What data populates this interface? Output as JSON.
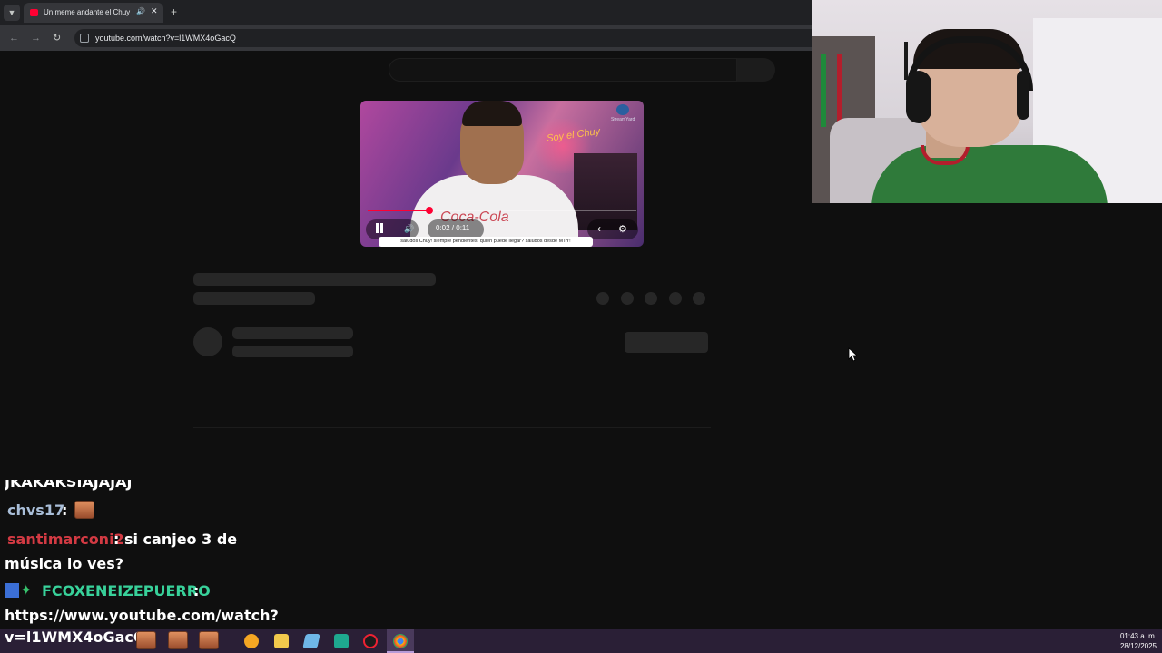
{
  "browser": {
    "tab_title": "Un meme andante el Chuy",
    "audio_icon": "speaker-icon",
    "new_tab_label": "+",
    "url": "youtube.com/watch?v=l1WMX4oGacQ"
  },
  "player": {
    "time": "0:02 / 0:11",
    "progress": 0.23,
    "neon_sign": "Soy el Chuy",
    "streamyard_label": "StreamYard",
    "caption": "saludos Chuy! siempre pendientes! quién puede llegar? saludos desde MTY!"
  },
  "chat": {
    "partial_line": "JKAKAKSIAJAJAJ",
    "messages": [
      {
        "user": "chvs17",
        "user_color": "#a9bed8",
        "text": ""
      },
      {
        "user": "santimarconi2",
        "user_color": "#d33a43",
        "text": ": si canjeo 3 de",
        "text_cont": "música lo ves?"
      },
      {
        "user": "FCOXENEIZEPUERRO",
        "user_color": "#38d19a",
        "text": " :",
        "text_cont": "https://www.youtube.com/watch?",
        "text_cont2": "v=l1WMX4oGacQ"
      }
    ]
  },
  "taskbar": {
    "clock_time": "01:43 a. m.",
    "clock_date": "28/12/2025"
  },
  "colors": {
    "youtube_red": "#ff0033",
    "page_bg": "#0f0f0f",
    "skeleton": "#272727",
    "taskbar_bg": "#2a1f36"
  }
}
